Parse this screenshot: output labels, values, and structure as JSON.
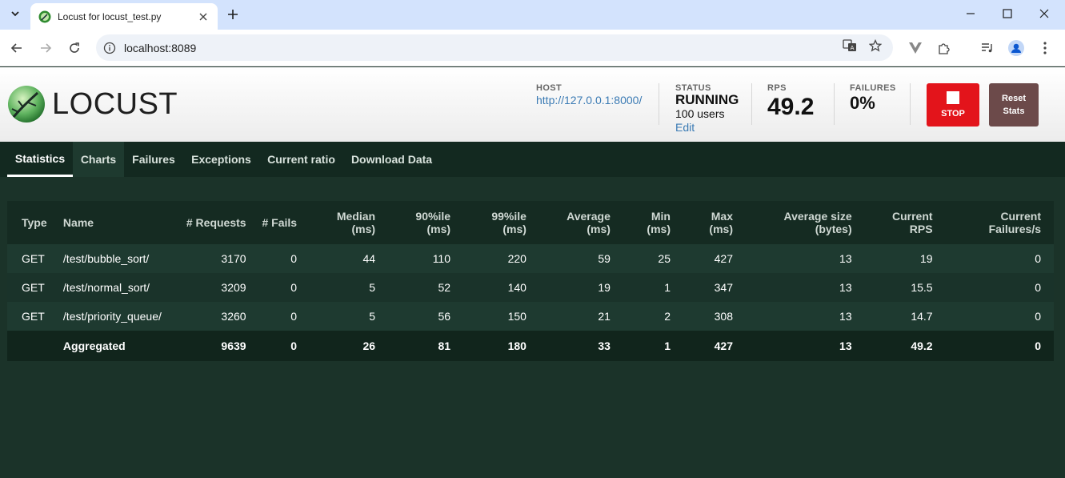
{
  "browser": {
    "tab_title": "Locust for locust_test.py",
    "url": "localhost:8089"
  },
  "header": {
    "logo_text": "LOCUST",
    "host_label": "HOST",
    "host_value": "http://127.0.0.1:8000/",
    "status_label": "STATUS",
    "status_value": "RUNNING",
    "users_value": "100 users",
    "edit_label": "Edit",
    "rps_label": "RPS",
    "rps_value": "49.2",
    "failures_label": "FAILURES",
    "failures_value": "0%",
    "stop_label": "STOP",
    "reset_line1": "Reset",
    "reset_line2": "Stats"
  },
  "tabs": [
    {
      "label": "Statistics"
    },
    {
      "label": "Charts"
    },
    {
      "label": "Failures"
    },
    {
      "label": "Exceptions"
    },
    {
      "label": "Current ratio"
    },
    {
      "label": "Download Data"
    }
  ],
  "table": {
    "columns": [
      {
        "l1": "Type",
        "l2": ""
      },
      {
        "l1": "Name",
        "l2": ""
      },
      {
        "l1": "# Requests",
        "l2": ""
      },
      {
        "l1": "# Fails",
        "l2": ""
      },
      {
        "l1": "Median",
        "l2": "(ms)"
      },
      {
        "l1": "90%ile",
        "l2": "(ms)"
      },
      {
        "l1": "99%ile",
        "l2": "(ms)"
      },
      {
        "l1": "Average",
        "l2": "(ms)"
      },
      {
        "l1": "Min",
        "l2": "(ms)"
      },
      {
        "l1": "Max",
        "l2": "(ms)"
      },
      {
        "l1": "Average size",
        "l2": "(bytes)"
      },
      {
        "l1": "Current",
        "l2": "RPS"
      },
      {
        "l1": "Current",
        "l2": "Failures/s"
      }
    ],
    "rows": [
      [
        "GET",
        "/test/bubble_sort/",
        "3170",
        "0",
        "44",
        "110",
        "220",
        "59",
        "25",
        "427",
        "13",
        "19",
        "0"
      ],
      [
        "GET",
        "/test/normal_sort/",
        "3209",
        "0",
        "5",
        "52",
        "140",
        "19",
        "1",
        "347",
        "13",
        "15.5",
        "0"
      ],
      [
        "GET",
        "/test/priority_queue/",
        "3260",
        "0",
        "5",
        "56",
        "150",
        "21",
        "2",
        "308",
        "13",
        "14.7",
        "0"
      ]
    ],
    "aggregated": [
      "",
      "Aggregated",
      "9639",
      "0",
      "26",
      "81",
      "180",
      "33",
      "1",
      "427",
      "13",
      "49.2",
      "0"
    ]
  },
  "colors": {
    "accent_stop": "#e3141b",
    "page_bg": "#1b3329",
    "link": "#3b7bb4"
  }
}
